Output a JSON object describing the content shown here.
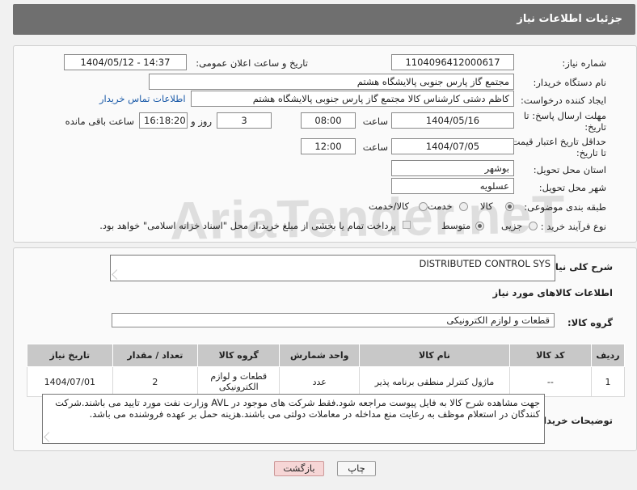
{
  "header": {
    "title": "جزئیات اطلاعات نیاز"
  },
  "labels": {
    "need_number": "شماره نیاز:",
    "announce_datetime": "تاریخ و ساعت اعلان عمومی:",
    "buyer_org": "نام دستگاه خریدار:",
    "requester": "ایجاد کننده درخواست:",
    "reply_deadline_1": "مهلت ارسال پاسخ: تا",
    "reply_deadline_2": "تاریخ:",
    "price_validity_1": "حداقل تاریخ اعتبار قیمت:",
    "price_validity_2": "تا تاریخ:",
    "hour": "ساعت",
    "day_and": "روز و",
    "hours_left": "ساعت باقی مانده",
    "province": "استان محل تحویل:",
    "city": "شهر محل تحویل:",
    "category": "طبقه بندی موضوعی:",
    "process_type": "نوع فرآیند خرید :",
    "general_desc": "شرح کلی نیاز:",
    "goods_info": "اطلاعات کالاهای مورد نیاز",
    "goods_group": "گروه کالا:",
    "buyer_notes": "توضیحات خریدار:"
  },
  "fields": {
    "need_number": "1104096412000617",
    "announce_datetime": "1404/05/12 - 14:37",
    "buyer_org": "مجتمع گاز پارس جنوبی  پالایشگاه هشتم",
    "requester": "کاظم دشتی کارشناس کالا مجتمع گاز پارس جنوبی  پالایشگاه هشتم",
    "contact_link": "اطلاعات تماس خریدار",
    "reply_date": "1404/05/16",
    "reply_time": "08:00",
    "reply_days": "3",
    "reply_remaining": "16:18:20",
    "validity_date": "1404/07/05",
    "validity_time": "12:00",
    "province": "بوشهر",
    "city": "عسلویه",
    "general_desc": "DISTRIBUTED CONTROL SYS",
    "goods_group": "قطعات و لوازم الکترونیکی",
    "buyer_notes": "جهت مشاهده شرح کالا به فایل پیوست مراجعه شود.فقط شرکت های موجود در AVL وزارت نفت مورد تایید می باشند.شرکت کنندگان در استعلام موظف به رعایت منع مداخله در معاملات دولتی می باشند.هزینه حمل بر عهده فروشنده می باشد."
  },
  "category_options": {
    "goods": "کالا",
    "service": "خدمت",
    "goods_service": "کالا/خدمت",
    "selected": "کالا"
  },
  "process_options": {
    "minor": "جزیی",
    "medium": "متوسط",
    "selected": "متوسط"
  },
  "payment_note": "پرداخت تمام یا بخشی از مبلغ خرید،از محل \"اسناد خزانه اسلامی\" خواهد بود.",
  "table": {
    "headers": [
      "ردیف",
      "کد کالا",
      "نام کالا",
      "واحد شمارش",
      "گروه کالا",
      "تعداد / مقدار",
      "تاریخ نیاز"
    ],
    "rows": [
      [
        "1",
        "--",
        "ماژول کنترلر منطقی برنامه پذیر",
        "عدد",
        "قطعات و لوازم الکترونیکی",
        "2",
        "1404/07/01"
      ]
    ]
  },
  "buttons": {
    "print": "چاپ",
    "back": "بازگشت"
  },
  "watermark": "AriaTender.neT",
  "colors": {
    "header_bg": "#6f6f6f",
    "link": "#1a5aa8",
    "back_button_bg": "#f6d6d6",
    "table_header_bg": "#c8c8c8"
  }
}
